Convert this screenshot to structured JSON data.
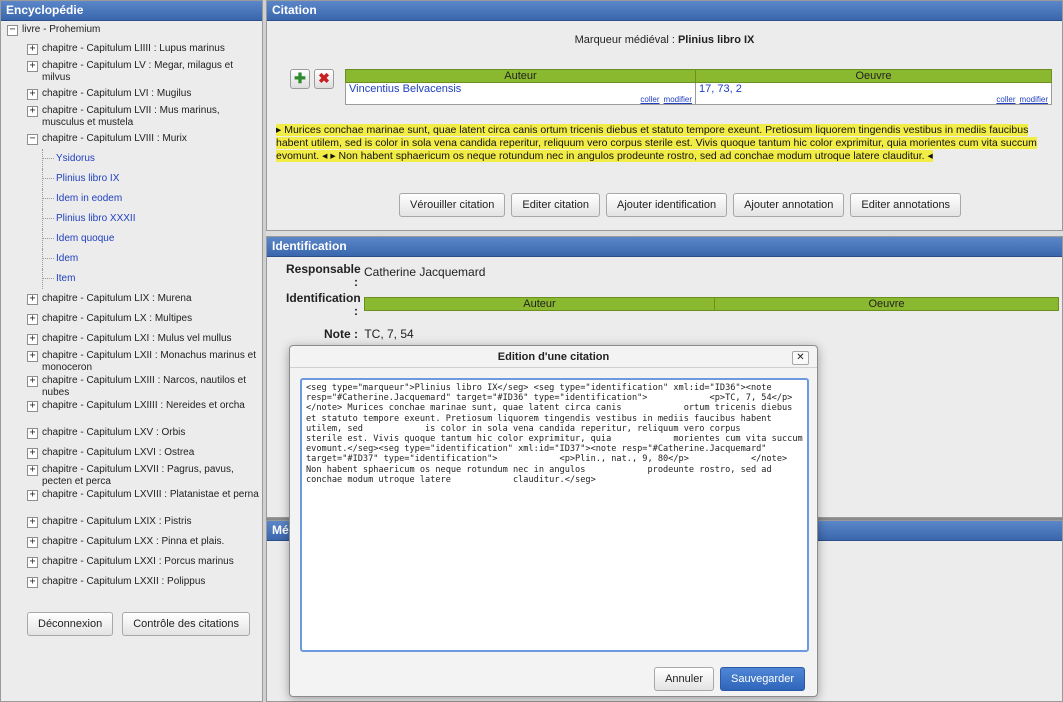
{
  "left_panel": {
    "title": "Encyclopédie",
    "root_label": "livre - Prohemium",
    "chapters_before": [
      "chapitre - Capitulum LIIII : Lupus marinus",
      "chapitre - Capitulum LV : Megar, milagus et milvus",
      "chapitre - Capitulum LVI : Mugilus",
      "chapitre - Capitulum LVII : Mus marinus, musculus et mustela"
    ],
    "open_chapter": "chapitre - Capitulum LVIII : Murix",
    "leaves": [
      "Ysidorus",
      "Plinius libro IX",
      "Idem in eodem",
      "Plinius libro XXXII",
      "Idem quoque",
      "Idem",
      "Item"
    ],
    "chapters_after": [
      "chapitre - Capitulum LIX : Murena",
      "chapitre - Capitulum LX : Multipes",
      "chapitre - Capitulum LXI : Mulus vel mullus",
      "chapitre - Capitulum LXII : Monachus marinus et monoceron",
      "chapitre - Capitulum LXIII : Narcos, nautilos et nubes",
      "chapitre - Capitulum LXIIII : Nereides et orcha",
      "chapitre - Capitulum LXV : Orbis",
      "chapitre - Capitulum LXVI : Ostrea",
      "chapitre - Capitulum LXVII : Pagrus, pavus, pecten et perca",
      "chapitre - Capitulum LXVIII : Platanistae et perna",
      "chapitre - Capitulum LXIX : Pistris",
      "chapitre - Capitulum LXX : Pinna et plais.",
      "chapitre - Capitulum LXXI : Porcus marinus",
      "chapitre - Capitulum LXXII : Polippus"
    ],
    "buttons": {
      "logout": "Déconnexion",
      "control": "Contrôle des citations"
    }
  },
  "citation": {
    "title": "Citation",
    "marqueur_label": "Marqueur médiéval :",
    "marqueur_value": "Plinius libro IX",
    "col_auteur": "Auteur",
    "col_oeuvre": "Oeuvre",
    "auteur_value": "Vincentius Belvacensis",
    "oeuvre_value": "17, 73, 2",
    "link_coller": "coller",
    "link_modifier": "modifier",
    "marker_open": "▸",
    "marker_close": "◂",
    "marker_between": "◂ ▸",
    "text_part1": "Murices conchae marinae sunt, quae latent circa canis ortum tricenis diebus et statuto tempore exeunt. Pretiosum liquorem tingendis vestibus in mediis faucibus habent utilem, sed is color in sola vena candida reperitur, reliquum vero corpus sterile est. Vivis quoque tantum hic color exprimitur, quia morientes cum vita succum evomunt.",
    "text_part2": "Non habent sphaericum os neque rotundum nec in angulos prodeunte rostro, sed ad conchae modum utroque latere clauditur.",
    "buttons": {
      "lock": "Vérouiller citation",
      "edit": "Editer citation",
      "add_ident": "Ajouter identification",
      "add_annot": "Ajouter annotation",
      "edit_annot": "Editer annotations"
    }
  },
  "identification": {
    "title": "Identification",
    "responsable_label": "Responsable",
    "responsable_colon": ":",
    "responsable_value": "Catherine Jacquemard",
    "identification_label": "Identification",
    "identification_colon": ":",
    "col_auteur": "Auteur",
    "col_oeuvre": "Oeuvre",
    "note_label": "Note :",
    "note_value": "TC, 7, 54"
  },
  "mentions": {
    "title_partial": "Mé"
  },
  "dialog": {
    "title": "Edition d'une citation",
    "close_glyph": "✕",
    "content": "<seg type=\"marqueur\">Plinius libro IX</seg> <seg type=\"identification\" xml:id=\"ID36\"><note resp=\"#Catherine.Jacquemard\" target=\"#ID36\" type=\"identification\">            <p>TC, 7, 54</p>            </note> Murices conchae marinae sunt, quae latent circa canis            ortum tricenis diebus et statuto tempore exeunt. Pretiosum liquorem tingendis vestibus in mediis faucibus habent utilem, sed            is color in sola vena candida reperitur, reliquum vero corpus            sterile est. Vivis quoque tantum hic color exprimitur, quia            morientes cum vita succum evomunt.</seg><seg type=\"identification\" xml:id=\"ID37\"><note resp=\"#Catherine.Jacquemard\" target=\"#ID37\" type=\"identification\">            <p>Plin., nat., 9, 80</p>            </note> Non habent sphaericum os neque rotundum nec in angulos            prodeunte rostro, sed ad conchae modum utroque latere            clauditur.</seg>",
    "cancel": "Annuler",
    "save": "Sauvegarder"
  }
}
